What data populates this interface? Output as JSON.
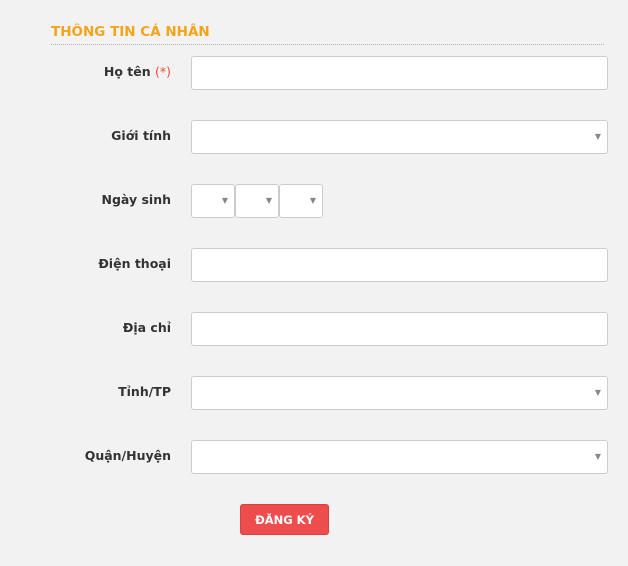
{
  "section": {
    "title": "THÔNG TIN CÁ NHÂN"
  },
  "fields": {
    "full_name": {
      "label": "Họ tên",
      "required_mark": "(*)",
      "value": ""
    },
    "gender": {
      "label": "Giới tính",
      "value": ""
    },
    "birthday": {
      "label": "Ngày sinh",
      "day": "",
      "month": "",
      "year": ""
    },
    "phone": {
      "label": "Điện thoại",
      "value": ""
    },
    "address": {
      "label": "Địa chỉ",
      "value": ""
    },
    "province": {
      "label": "Tỉnh/TP",
      "value": ""
    },
    "district": {
      "label": "Quận/Huyện",
      "value": ""
    }
  },
  "icons": {
    "dropdown_caret": "▼"
  },
  "submit": {
    "label": "ĐĂNG KÝ"
  },
  "colors": {
    "accent": "#f5a31a",
    "button": "#ee4d4d",
    "required": "#e84c3d"
  }
}
